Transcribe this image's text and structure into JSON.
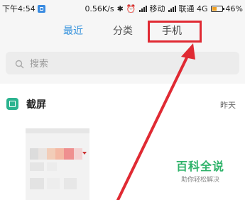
{
  "status_bar": {
    "time": "下午4:54",
    "speed": "0.56K/s",
    "carrier1": "移动",
    "carrier2": "联通 4G",
    "battery": "46%"
  },
  "tabs": [
    {
      "label": "最近",
      "active": true
    },
    {
      "label": "分类",
      "active": false
    },
    {
      "label": "手机",
      "active": false
    }
  ],
  "search": {
    "placeholder": "搜索"
  },
  "section": {
    "title": "截屏",
    "date": "昨天"
  },
  "watermark": {
    "title": "百科全说",
    "subtitle": "助你轻松解决"
  },
  "colors": {
    "accent": "#2f8fdc",
    "highlight": "#e02a33",
    "section_icon": "#2bb38f",
    "watermark": "#2fb36a"
  }
}
